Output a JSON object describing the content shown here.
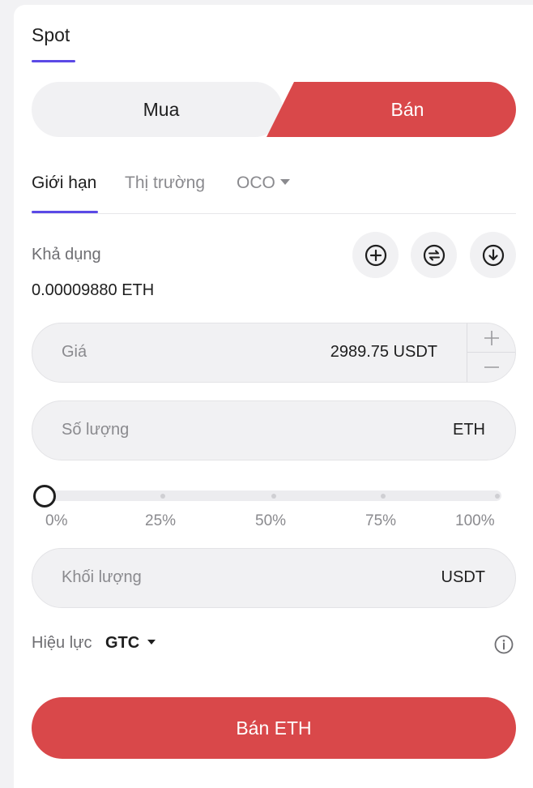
{
  "tabs": {
    "spot_label": "Spot"
  },
  "side_toggle": {
    "buy_label": "Mua",
    "sell_label": "Bán",
    "active": "sell"
  },
  "order_types": [
    {
      "label": "Giới hạn",
      "active": true
    },
    {
      "label": "Thị trường",
      "active": false
    },
    {
      "label": "OCO",
      "active": false
    }
  ],
  "available": {
    "label": "Khả dụng",
    "value": "0.00009880 ETH"
  },
  "action_icons": [
    "plus-circle-icon",
    "swap-circle-icon",
    "download-circle-icon"
  ],
  "price_field": {
    "label": "Giá",
    "value": "2989.75 USDT"
  },
  "quantity_field": {
    "label": "Số lượng",
    "unit": "ETH"
  },
  "percent_slider": {
    "value_percent": 0,
    "marks": [
      "0%",
      "25%",
      "50%",
      "75%",
      "100%"
    ]
  },
  "total_field": {
    "label": "Khối lượng",
    "unit": "USDT"
  },
  "time_in_force": {
    "label": "Hiệu lực",
    "value": "GTC"
  },
  "submit": {
    "label": "Bán ETH"
  },
  "colors": {
    "accent": "#5b49e6",
    "sell": "#d9484a",
    "field_bg": "#f1f1f3"
  }
}
